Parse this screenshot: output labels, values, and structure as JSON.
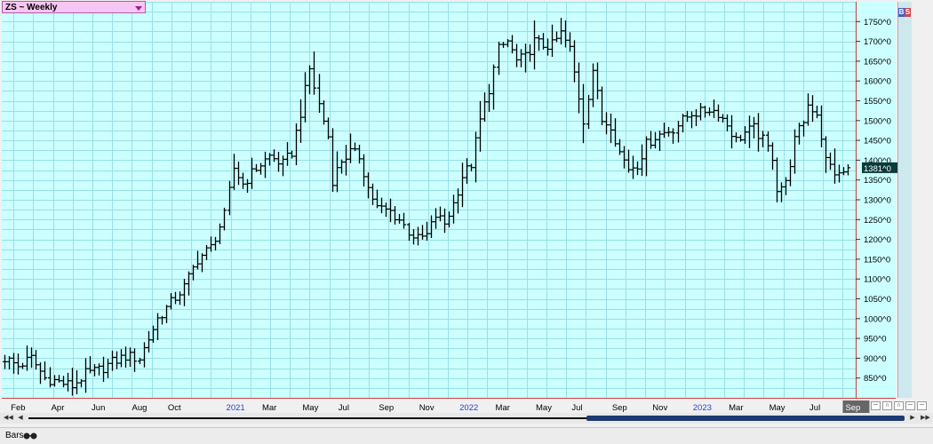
{
  "header": {
    "symbol_label": "ZS ~ Weekly"
  },
  "badges": {
    "b": "B",
    "s": "S"
  },
  "price_tag": {
    "text": "1381^0"
  },
  "footer": {
    "chart_style_label": "Bars"
  },
  "colors": {
    "plot_bg": "#ccffff",
    "grid": "#99e0e6",
    "bar": "#000000",
    "red_line": "#d04040",
    "year_label": "#2244cc"
  },
  "chart_data": {
    "type": "bar",
    "style": "ohlc",
    "ylim": [
      800,
      1800
    ],
    "y_tick_labels": [
      "850^0",
      "900^0",
      "950^0",
      "1000^0",
      "1050^0",
      "1100^0",
      "1150^0",
      "1200^0",
      "1250^0",
      "1300^0",
      "1350^0",
      "1400^0",
      "1450^0",
      "1500^0",
      "1550^0",
      "1600^0",
      "1650^0",
      "1700^0",
      "1750^0"
    ],
    "y_tick_values": [
      850,
      900,
      950,
      1000,
      1050,
      1100,
      1150,
      1200,
      1250,
      1300,
      1350,
      1400,
      1450,
      1500,
      1550,
      1600,
      1650,
      1700,
      1750
    ],
    "x_tick_labels": [
      {
        "label": "Feb",
        "week": 3,
        "year": false
      },
      {
        "label": "Apr",
        "week": 12,
        "year": false
      },
      {
        "label": "Jun",
        "week": 21,
        "year": false
      },
      {
        "label": "Aug",
        "week": 30,
        "year": false
      },
      {
        "label": "Oct",
        "week": 38,
        "year": false
      },
      {
        "label": "2021",
        "week": 51,
        "year": true
      },
      {
        "label": "Mar",
        "week": 59,
        "year": false
      },
      {
        "label": "May",
        "week": 68,
        "year": false
      },
      {
        "label": "Jul",
        "week": 76,
        "year": false
      },
      {
        "label": "Sep",
        "week": 85,
        "year": false
      },
      {
        "label": "Nov",
        "week": 94,
        "year": false
      },
      {
        "label": "2022",
        "week": 103,
        "year": true
      },
      {
        "label": "Mar",
        "week": 111,
        "year": false
      },
      {
        "label": "May",
        "week": 120,
        "year": false
      },
      {
        "label": "Jul",
        "week": 128,
        "year": false
      },
      {
        "label": "Sep",
        "week": 137,
        "year": false
      },
      {
        "label": "Nov",
        "week": 146,
        "year": false
      },
      {
        "label": "2023",
        "week": 155,
        "year": true
      },
      {
        "label": "Mar",
        "week": 163,
        "year": false
      },
      {
        "label": "May",
        "week": 172,
        "year": false
      },
      {
        "label": "Jul",
        "week": 181,
        "year": false
      },
      {
        "label": "Sep",
        "week": 189,
        "year": false,
        "highlight": true
      }
    ],
    "last_price": 1381,
    "anchors": [
      [
        0,
        900
      ],
      [
        3,
        880
      ],
      [
        6,
        900
      ],
      [
        9,
        850
      ],
      [
        12,
        840
      ],
      [
        15,
        830
      ],
      [
        18,
        860
      ],
      [
        21,
        870
      ],
      [
        24,
        890
      ],
      [
        27,
        905
      ],
      [
        30,
        900
      ],
      [
        32,
        950
      ],
      [
        34,
        1000
      ],
      [
        37,
        1040
      ],
      [
        40,
        1080
      ],
      [
        43,
        1150
      ],
      [
        46,
        1180
      ],
      [
        49,
        1260
      ],
      [
        51,
        1380
      ],
      [
        53,
        1340
      ],
      [
        56,
        1380
      ],
      [
        59,
        1410
      ],
      [
        62,
        1390
      ],
      [
        64,
        1420
      ],
      [
        66,
        1520
      ],
      [
        68,
        1630
      ],
      [
        70,
        1540
      ],
      [
        72,
        1460
      ],
      [
        73,
        1350
      ],
      [
        75,
        1400
      ],
      [
        77,
        1420
      ],
      [
        79,
        1410
      ],
      [
        81,
        1330
      ],
      [
        83,
        1280
      ],
      [
        86,
        1270
      ],
      [
        88,
        1250
      ],
      [
        90,
        1220
      ],
      [
        92,
        1200
      ],
      [
        94,
        1210
      ],
      [
        96,
        1260
      ],
      [
        98,
        1240
      ],
      [
        100,
        1290
      ],
      [
        102,
        1360
      ],
      [
        104,
        1390
      ],
      [
        106,
        1500
      ],
      [
        108,
        1580
      ],
      [
        110,
        1680
      ],
      [
        112,
        1700
      ],
      [
        114,
        1650
      ],
      [
        116,
        1660
      ],
      [
        118,
        1700
      ],
      [
        120,
        1690
      ],
      [
        122,
        1690
      ],
      [
        124,
        1720
      ],
      [
        126,
        1680
      ],
      [
        127,
        1620
      ],
      [
        129,
        1500
      ],
      [
        131,
        1630
      ],
      [
        133,
        1500
      ],
      [
        135,
        1490
      ],
      [
        137,
        1420
      ],
      [
        139,
        1380
      ],
      [
        141,
        1390
      ],
      [
        143,
        1440
      ],
      [
        145,
        1460
      ],
      [
        147,
        1470
      ],
      [
        149,
        1480
      ],
      [
        151,
        1500
      ],
      [
        153,
        1520
      ],
      [
        155,
        1520
      ],
      [
        157,
        1530
      ],
      [
        159,
        1520
      ],
      [
        161,
        1490
      ],
      [
        163,
        1450
      ],
      [
        165,
        1470
      ],
      [
        167,
        1480
      ],
      [
        169,
        1450
      ],
      [
        171,
        1410
      ],
      [
        172,
        1330
      ],
      [
        174,
        1340
      ],
      [
        176,
        1450
      ],
      [
        178,
        1500
      ],
      [
        179,
        1540
      ],
      [
        181,
        1520
      ],
      [
        183,
        1400
      ],
      [
        185,
        1370
      ],
      [
        186,
        1360
      ],
      [
        188,
        1380
      ]
    ]
  }
}
